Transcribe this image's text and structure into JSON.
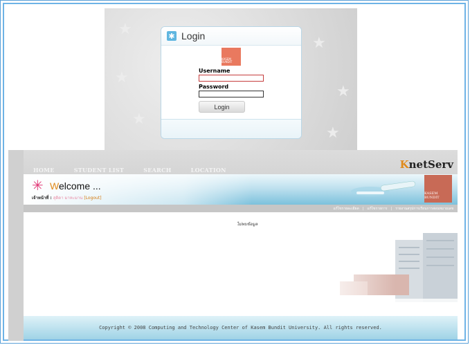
{
  "login": {
    "title": "Login",
    "username_label": "Username",
    "password_label": "Password",
    "username_value": "",
    "password_value": "",
    "button_label": "Login",
    "logo_text": "KASEM BUNDIT"
  },
  "app": {
    "brand_first": "K",
    "brand_rest": "netServ",
    "nav": [
      "HOME",
      "STUDENT LIST",
      "SEARCH",
      "LOCATION"
    ],
    "welcome_first": "W",
    "welcome_rest": "elcome ...",
    "officer_label": "เจ้าหน้าที่ :",
    "officer_name": "สุดิดา มาหะมาน",
    "logout_label": "[Logout]",
    "logo_text": "KASEM BUNDIT",
    "subnav": [
      "แก้ไขรายละเอียด",
      "แก้ไขรายการ",
      "รายงานสรุปการเรียนการสอนหมายเลข"
    ],
    "no_data": "ไม่พบข้อมูล",
    "footer": "Copyright © 2008 Computing and Technology Center of Kasem Bundit University. All rights reserved."
  },
  "colors": {
    "accent_orange": "#e08a1a",
    "asterisk_pink": "#e23a78",
    "band_blue": "#7cc1dc",
    "frame_blue": "#6eb3e6"
  },
  "icons": {
    "login_icon": "asterisk-icon",
    "welcome_icon": "asterisk-icon"
  }
}
